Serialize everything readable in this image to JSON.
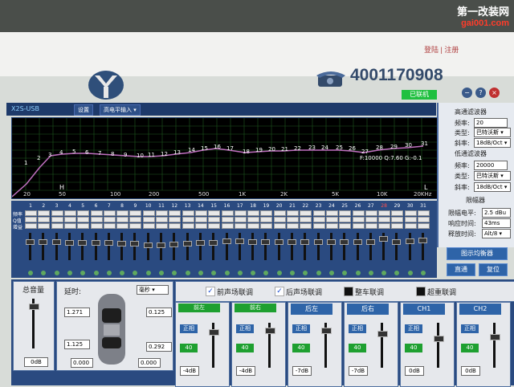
{
  "watermark": {
    "line1": "第一改装网",
    "line2": "gai001.com"
  },
  "top_links": {
    "login": "登陆",
    "register": "注册"
  },
  "hotline": "4001170908",
  "status": "已联机",
  "window_buttons": {
    "minimize": "−",
    "help": "?",
    "close": "×"
  },
  "app": {
    "title": "X2S-USB",
    "tab_settings": "设置",
    "tab_input": "高电平输入 ▾"
  },
  "colors": {
    "curve": "#c070c0",
    "grid": "#2a6a2a",
    "accent": "#2e64a8",
    "green": "#1ea030"
  },
  "eq_graph": {
    "x_labels": [
      "20",
      "50",
      "100",
      "200",
      "500",
      "1K",
      "2K",
      "5K",
      "10K",
      "20KHz"
    ],
    "left_marker": "H",
    "right_marker": "L",
    "selected_info": "F:10000 Q:7.60 G:-0.1",
    "points": [
      "1",
      "2",
      "3",
      "4",
      "5",
      "6",
      "7",
      "8",
      "9",
      "10",
      "11",
      "12",
      "13",
      "14",
      "15",
      "16",
      "17",
      "18",
      "19",
      "20",
      "21",
      "22",
      "23",
      "24",
      "25",
      "26",
      "27",
      "28",
      "29",
      "30",
      "31"
    ]
  },
  "bands": {
    "numbers": [
      "1",
      "2",
      "3",
      "4",
      "5",
      "6",
      "7",
      "8",
      "9",
      "10",
      "11",
      "12",
      "13",
      "14",
      "15",
      "16",
      "17",
      "18",
      "19",
      "20",
      "21",
      "22",
      "23",
      "24",
      "25",
      "26",
      "27",
      "28",
      "29",
      "30",
      "31"
    ],
    "row_labels": [
      "频率",
      "Q值",
      "增益"
    ],
    "selected_band": "28"
  },
  "highpass": {
    "title": "高通滤波器",
    "freq_label": "频率:",
    "freq_value": "20",
    "type_label": "类型:",
    "type_value": "巴特沃斯 ▾",
    "slope_label": "斜率:",
    "slope_value": "18dB/Oct ▾"
  },
  "lowpass": {
    "title": "低通滤波器",
    "freq_label": "频率:",
    "freq_value": "20000",
    "type_label": "类型:",
    "type_value": "巴特沃斯 ▾",
    "slope_label": "斜率:",
    "slope_value": "18dB/Oct ▾"
  },
  "limiter": {
    "title": "限幅器",
    "level_label": "限幅电平:",
    "level_value": "2.5 dBu",
    "attack_label": "响应时间:",
    "attack_value": "43ms",
    "release_label": "释放时间:",
    "release_value": "Alt/8 ▾"
  },
  "right_buttons": {
    "eq_graph": "图示均衡器",
    "bypass": "直通",
    "reset": "复位"
  },
  "master": {
    "label": "总音量",
    "value": "0dB"
  },
  "delay": {
    "label": "延时:",
    "unit": "毫秒 ▾",
    "values": [
      "1.271",
      "0.125",
      "1.125",
      "0.292",
      "0.000",
      "0.000"
    ]
  },
  "links": {
    "front": "前声场联调",
    "rear": "后声场联调",
    "all": "整车联调",
    "sub": "超重联调"
  },
  "channels": [
    {
      "head": "",
      "invert": "正相",
      "mute": "40",
      "value": "-4dB"
    },
    {
      "head": "",
      "invert": "正相",
      "mute": "40",
      "value": "-4dB"
    },
    {
      "head": "后左",
      "invert": "正相",
      "mute": "40",
      "value": "-7dB"
    },
    {
      "head": "后右",
      "invert": "正相",
      "mute": "40",
      "value": "-7dB"
    },
    {
      "head": "CH1",
      "invert": "正相",
      "mute": "40",
      "value": "0dB"
    },
    {
      "head": "CH2",
      "invert": "正相",
      "mute": "40",
      "value": "0dB"
    }
  ],
  "channel_green_heads": [
    "前左",
    "前右"
  ]
}
